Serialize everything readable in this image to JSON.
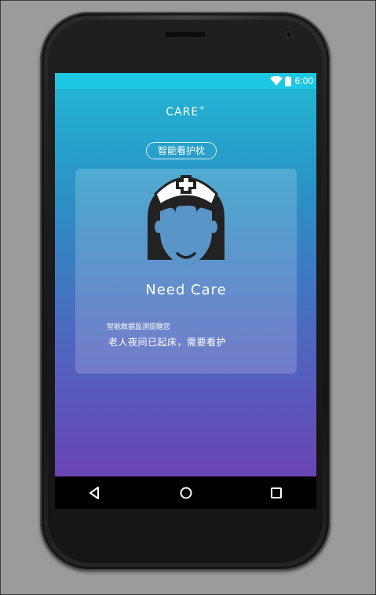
{
  "status_bar": {
    "time": "6:00",
    "icons": [
      "wifi-icon",
      "battery-icon"
    ]
  },
  "app": {
    "brand": "CARE",
    "brand_superscript": "+",
    "subtitle": "智能看护枕",
    "card": {
      "icon": "nurse-icon",
      "title": "Need Care",
      "small_text": "智能数据监测提醒您",
      "message": "老人夜间已起床，需要看护"
    }
  },
  "nav_bar": {
    "buttons": [
      "back-icon",
      "home-icon",
      "recent-apps-icon"
    ]
  },
  "colors": {
    "gradient_top": "#21b8d4",
    "gradient_bottom": "#6a45b4",
    "status_bar": "#1ec8e4",
    "icon_dark": "#222222"
  }
}
